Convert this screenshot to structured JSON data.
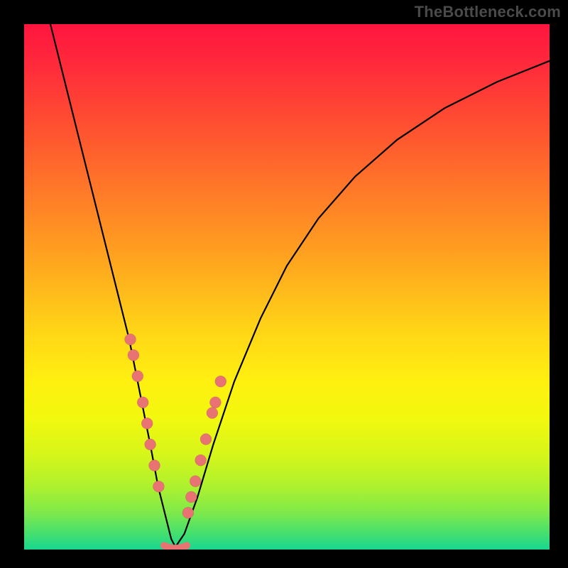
{
  "watermark": "TheBottleneck.com",
  "colors": {
    "frame": "#000000",
    "watermark_text": "#4a4a4a",
    "curve": "#000000",
    "dot": "#e97373",
    "gradient_top": "#ff153f",
    "gradient_bottom": "#18d68f"
  },
  "chart_data": {
    "type": "line",
    "title": "",
    "xlabel": "",
    "ylabel": "",
    "xlim": [
      0,
      100
    ],
    "ylim": [
      0,
      100
    ],
    "grid": false,
    "legend": false,
    "series": [
      {
        "name": "bottleneck-curve",
        "x": [
          5,
          8,
          11,
          14,
          17,
          20,
          22,
          24,
          25.5,
          27,
          28,
          28.8,
          30.5,
          33,
          36,
          40,
          45,
          50,
          56,
          63,
          71,
          80,
          90,
          100
        ],
        "y": [
          100,
          88,
          76,
          64,
          52,
          40,
          30,
          20,
          12,
          6,
          2,
          0.5,
          3,
          10,
          20,
          32,
          44,
          54,
          63,
          71,
          78,
          84,
          89,
          93
        ]
      }
    ],
    "highlight_points": {
      "name": "marker-dots",
      "left_branch": [
        {
          "x": 20.2,
          "y": 40
        },
        {
          "x": 20.8,
          "y": 37
        },
        {
          "x": 21.6,
          "y": 33
        },
        {
          "x": 22.6,
          "y": 28
        },
        {
          "x": 23.4,
          "y": 24
        },
        {
          "x": 24.0,
          "y": 20
        },
        {
          "x": 24.8,
          "y": 16
        },
        {
          "x": 25.6,
          "y": 12
        }
      ],
      "right_branch": [
        {
          "x": 31.2,
          "y": 7
        },
        {
          "x": 31.8,
          "y": 10
        },
        {
          "x": 32.6,
          "y": 13
        },
        {
          "x": 33.6,
          "y": 17
        },
        {
          "x": 34.6,
          "y": 21
        },
        {
          "x": 35.8,
          "y": 26
        },
        {
          "x": 36.4,
          "y": 28
        },
        {
          "x": 37.4,
          "y": 32
        }
      ],
      "minimum": {
        "x": 28.8,
        "y": 0.5
      }
    }
  }
}
